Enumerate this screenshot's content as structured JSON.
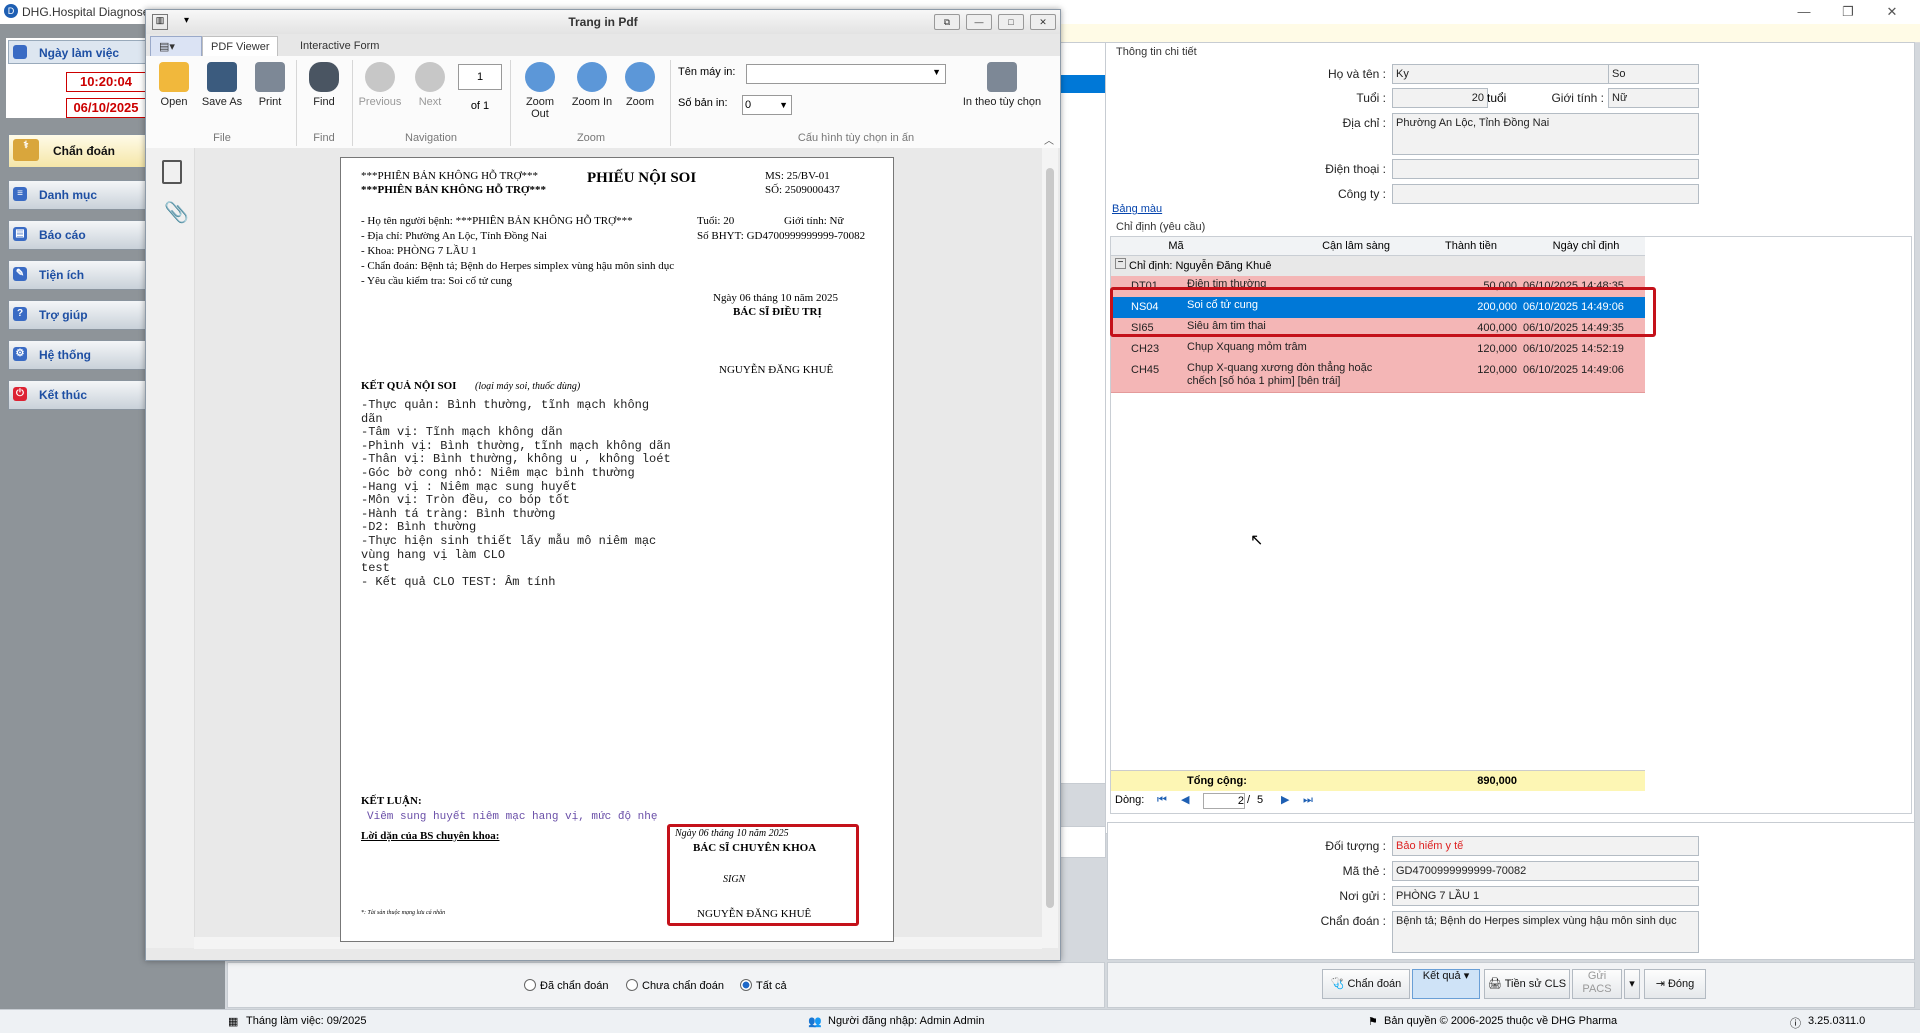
{
  "app": {
    "title": "DHG.Hospital Diagnose"
  },
  "sidebar": {
    "date_header": "Ngày làm việc",
    "time": "10:20:04",
    "date": "06/10/2025",
    "items": [
      {
        "label": "Chẩn đoán",
        "icon": "stethoscope-icon"
      },
      {
        "label": "Danh mục",
        "icon": "list-icon"
      },
      {
        "label": "Báo cáo",
        "icon": "report-icon"
      },
      {
        "label": "Tiện ích",
        "icon": "tools-icon"
      },
      {
        "label": "Trợ giúp",
        "icon": "help-icon"
      },
      {
        "label": "Hệ thống",
        "icon": "gear-icon"
      },
      {
        "label": "Kết thúc",
        "icon": "power-icon"
      }
    ]
  },
  "pdf": {
    "window_title": "Trang in Pdf",
    "tabs": [
      "PDF Viewer",
      "Interactive Form"
    ],
    "ribbon": {
      "open": "Open",
      "save_as": "Save As",
      "print": "Print",
      "find": "Find",
      "previous": "Previous",
      "next": "Next",
      "page_value": "1",
      "page_of": "of 1",
      "zoom_out": "Zoom Out",
      "zoom_in": "Zoom In",
      "zoom": "Zoom",
      "printer_label": "Tên máy in:",
      "printer_value": "",
      "copies_label": "Số bản in:",
      "copies_value": "0",
      "print_custom": "In theo tùy chọn",
      "groups": {
        "file": "File",
        "find": "Find",
        "navigation": "Navigation",
        "zoom": "Zoom",
        "print_config": "Cấu hình tùy chọn in ấn"
      }
    },
    "document": {
      "watermark1": "***PHIÊN BẢN KHÔNG HỖ TRỢ***",
      "watermark2": "***PHIÊN BẢN KHÔNG HỖ TRỢ***",
      "title": "PHIẾU NỘI SOI",
      "ms": "MS: 25/BV-01",
      "so": "SỐ: 2509000437",
      "patient_name": "- Họ tên người bệnh: ***PHIÊN BẢN KHÔNG HỖ TRỢ***",
      "age": "Tuổi: 20",
      "gender": "Giới tính: Nữ",
      "address": "- Địa chỉ: Phường An Lộc, Tỉnh Đồng Nai",
      "bhyt": "Số BHYT: GD4700999999999-70082",
      "dept": "- Khoa: PHÒNG 7 LẦU 1",
      "diagnosis": "- Chẩn đoán: Bệnh tả; Bệnh do Herpes simplex vùng hậu môn sinh dục",
      "request": "- Yêu cầu kiểm tra: Soi cổ tử cung",
      "date_line": "Ngày 06 tháng 10 năm 2025",
      "doctor_title": "BÁC SĨ ĐIỀU TRỊ",
      "doctor_name": "NGUYỄN ĐĂNG KHUÊ",
      "result_title": "KẾT QUẢ NỘI SOI",
      "result_note": "(loại máy soi, thuốc dùng)",
      "result_lines": [
        "-Thực quản: Bình thường, tĩnh mạch không",
        "dãn",
        "-Tâm vị: Tĩnh mạch không dãn",
        "-Phình vị: Bình thường, tĩnh mạch không dãn",
        "-Thân vị: Bình thường, không u , không loét",
        "-Góc bờ cong nhỏ: Niêm mạc bình thường",
        "-Hang vị : Niêm mạc sung huyết",
        "-Môn vị: Tròn đều, co bóp tốt",
        "-Hành tá tràng: Bình thường",
        "-D2: Bình thường",
        "-Thực hiện sinh thiết lấy mẫu mô niêm mạc",
        "vùng hang vị làm CLO",
        "test",
        "- Kết quả CLO TEST: Âm tính"
      ],
      "conclusion_title": "KẾT LUẬN:",
      "conclusion": "Viêm sung huyết niêm mạc hang vị, mức độ nhẹ",
      "advice": "Lời dặn của BS chuyên khoa:",
      "date_line2": "Ngày 06 tháng 10 năm 2025",
      "specialist_title": "BÁC SĨ CHUYÊN KHOA",
      "signature": "SIGN",
      "specialist_name": "NGUYỄN ĐĂNG KHUÊ",
      "footnote": "*: Tài sản thuộc mạng lưu cá nhân"
    }
  },
  "detail": {
    "section": "Thông tin chi tiết",
    "name_label": "Họ và tên :",
    "name_first": "Ky",
    "name_last": "So",
    "age_label": "Tuổi :",
    "age": "20",
    "age_unit": "tuổi",
    "gender_label": "Giới tính :",
    "gender": "Nữ",
    "address_label": "Địa chỉ :",
    "address": "Phường An Lộc, Tỉnh Đồng Nai",
    "phone_label": "Điện thoại :",
    "phone": "",
    "company_label": "Công ty :",
    "company": "",
    "color_table": "Bảng màu",
    "orders_section": "Chỉ định (yêu cầu)",
    "columns": [
      "Mã",
      "Cận lâm sàng",
      "Thành tiền",
      "Ngày chỉ định"
    ],
    "group_row": "Chỉ định:  Nguyễn Đăng Khuê",
    "rows": [
      {
        "code": "DT01",
        "name": "Điện tim thường",
        "price": "50,000",
        "date": "06/10/2025 14:48:35"
      },
      {
        "code": "NS04",
        "name": "Soi cổ tử cung",
        "price": "200,000",
        "date": "06/10/2025 14:49:06"
      },
      {
        "code": "SI65",
        "name": "Siêu âm tim thai",
        "price": "400,000",
        "date": "06/10/2025 14:49:35"
      },
      {
        "code": "CH23",
        "name": "Chụp Xquang mỏm trâm",
        "price": "120,000",
        "date": "06/10/2025 14:52:19"
      },
      {
        "code": "CH45",
        "name": "Chụp X-quang xương đòn thẳng hoặc chếch [số hóa 1 phim] [bên trái]",
        "price": "120,000",
        "date": "06/10/2025 14:49:06"
      }
    ],
    "total_label": "Tổng cộng:",
    "total": "890,000",
    "nav_label": "Dòng:",
    "nav_current": "2",
    "nav_total": "5",
    "object_label": "Đối tượng :",
    "object": "Bảo hiểm y tế",
    "card_label": "Mã thẻ :",
    "card": "GD4700999999999-70082",
    "send_label": "Nơi gửi :",
    "send": "PHÒNG 7 LẦU 1",
    "diag_label": "Chẩn đoán :",
    "diag": "Bệnh tả; Bệnh do Herpes simplex vùng hậu môn sinh dục"
  },
  "filters": {
    "opt1": "Đã chẩn đoán",
    "opt2": "Chưa chẩn đoán",
    "opt3": "Tất cả"
  },
  "actions": {
    "diagnose": "Chẩn đoán",
    "result": "Kết quả",
    "history": "Tiền sử CLS",
    "send_pacs": "Gửi PACS",
    "close": "Đóng"
  },
  "footer": {
    "work_month": "Tháng làm việc: 09/2025",
    "login": "Người đăng nhập: Admin Admin",
    "copyright": "Bản quyền © 2006-2025 thuộc về DHG Pharma",
    "version": "3.25.0311.0"
  },
  "colors": {
    "accent": "#0a6ed1",
    "highlight_row": "#0078d7",
    "pink_row": "#f4b6b6",
    "red_box": "#c4111a"
  }
}
